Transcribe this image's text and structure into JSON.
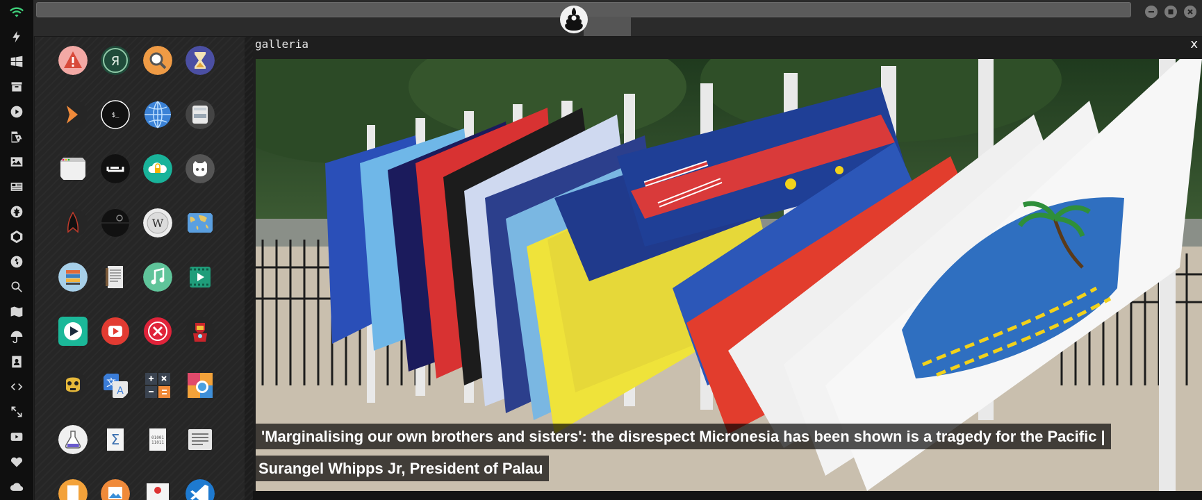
{
  "dock": {
    "items": [
      {
        "name": "wifi-icon"
      },
      {
        "name": "bolt-icon"
      },
      {
        "name": "windows-icon"
      },
      {
        "name": "archive-icon"
      },
      {
        "name": "play-icon"
      },
      {
        "name": "translate-icon"
      },
      {
        "name": "image-icon"
      },
      {
        "name": "news-icon"
      },
      {
        "name": "rebel-icon"
      },
      {
        "name": "empire-icon"
      },
      {
        "name": "globe-icon"
      },
      {
        "name": "search-icon"
      },
      {
        "name": "map-icon"
      },
      {
        "name": "umbrella-icon"
      },
      {
        "name": "contacts-icon"
      },
      {
        "name": "code-icon"
      },
      {
        "name": "expand-icon"
      },
      {
        "name": "youtube-icon"
      },
      {
        "name": "heart-icon"
      },
      {
        "name": "cloud-icon"
      }
    ]
  },
  "launcher": {
    "apps": [
      {
        "name": "warning-app-icon"
      },
      {
        "name": "yandex-app-icon"
      },
      {
        "name": "search-app-icon"
      },
      {
        "name": "hourglass-app-icon"
      },
      {
        "name": "terminal-arrow-app-icon"
      },
      {
        "name": "shell-app-icon"
      },
      {
        "name": "globe-app-icon"
      },
      {
        "name": "drive-app-icon"
      },
      {
        "name": "window-app-icon"
      },
      {
        "name": "sleep-app-icon"
      },
      {
        "name": "cloud-lock-app-icon"
      },
      {
        "name": "github-app-icon"
      },
      {
        "name": "starfleet-app-icon"
      },
      {
        "name": "death-star-app-icon"
      },
      {
        "name": "wikipedia-app-icon"
      },
      {
        "name": "world-map-app-icon"
      },
      {
        "name": "books-app-icon"
      },
      {
        "name": "document-app-icon"
      },
      {
        "name": "music-app-icon"
      },
      {
        "name": "video-app-icon"
      },
      {
        "name": "media-player-app-icon"
      },
      {
        "name": "youtube-app-icon"
      },
      {
        "name": "close-app-icon"
      },
      {
        "name": "ironman-app-icon"
      },
      {
        "name": "c3po-app-icon"
      },
      {
        "name": "translate-app-icon"
      },
      {
        "name": "calculator-app-icon"
      },
      {
        "name": "screenshot-app-icon"
      },
      {
        "name": "lab-app-icon"
      },
      {
        "name": "sigma-app-icon"
      },
      {
        "name": "binary-app-icon"
      },
      {
        "name": "text-app-icon"
      },
      {
        "name": "doc-orange-app-icon"
      },
      {
        "name": "image-app-icon"
      },
      {
        "name": "presentation-app-icon"
      },
      {
        "name": "vscode-app-icon"
      }
    ]
  },
  "window": {
    "title": "galleria",
    "close_label": "x",
    "caption_line1": " 'Marginalising our own brothers and sisters': the disrespect Micronesia has been shown is a tragedy for the Pacific |",
    "caption_line2": "Surangel Whipps Jr, President of Palau"
  },
  "colors": {
    "accent_wifi": "#3fd07a",
    "palau_blue": "#2f6fc0",
    "palau_gold": "#f2d21a"
  }
}
